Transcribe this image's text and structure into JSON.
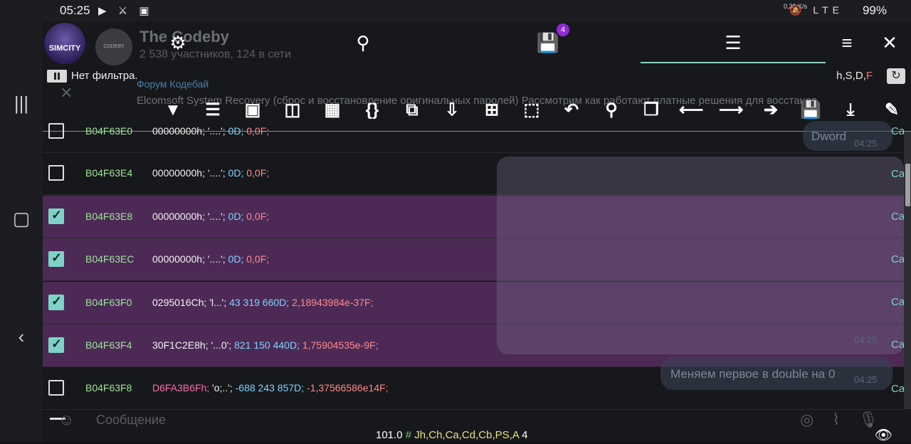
{
  "status_bar": {
    "time": "05:25",
    "left_icons": "▶ ⚔ ▣",
    "net_speed": "0,22\nK/s",
    "right_icons": "🔕 LTE",
    "battery": "99%"
  },
  "telegram": {
    "chat_title": "The Codeby",
    "chat_subtitle": "2 538 участников, 124 в сети",
    "pinned_title": "Форум Кодебай",
    "pinned_text": "Elcomsoft System Recovery (сброс и восстановление оригинальных паролей) Рассмотрим как работают платные решения для восстанов",
    "avatar_game_text": "SIMCITY",
    "avatar_chat_text": "CODEBY",
    "message_placeholder": "Сообщение",
    "bubble_dword": "Dword",
    "bubble_dword_time": "04:25",
    "bubble_change": "Меняем первое в double на 0",
    "bubble_change_time": "04:25",
    "overlay_time": "04:25",
    "side_label": "Ca"
  },
  "gg_top": {
    "badge": "4",
    "filter_text": "Нет фильтра.",
    "types_prefix": "h,S,D,",
    "types_float": "F"
  },
  "gg_toolbar": [
    {
      "name": "filter-icon",
      "glyph": "▼"
    },
    {
      "name": "select-list-icon",
      "glyph": "☰"
    },
    {
      "name": "select-all-icon",
      "glyph": "▣"
    },
    {
      "name": "select-inverse-icon",
      "glyph": "◫"
    },
    {
      "name": "calculator-icon",
      "glyph": "▦"
    },
    {
      "name": "braces-icon",
      "glyph": "{}"
    },
    {
      "name": "copy-move-icon",
      "glyph": "⧉"
    },
    {
      "name": "folder-download-icon",
      "glyph": "⇩"
    },
    {
      "name": "offset-icon",
      "glyph": "⊞"
    },
    {
      "name": "deselect-icon",
      "glyph": "⬚"
    },
    {
      "name": "undo-icon",
      "glyph": "↶"
    },
    {
      "name": "search-plus-icon",
      "glyph": "⚲"
    },
    {
      "name": "copy-icon",
      "glyph": "❐"
    },
    {
      "name": "arrow-left-icon",
      "glyph": "⟵"
    },
    {
      "name": "arrow-right-icon",
      "glyph": "⟶"
    },
    {
      "name": "goto-icon",
      "glyph": "➔"
    },
    {
      "name": "save-icon",
      "glyph": "💾"
    },
    {
      "name": "download-icon",
      "glyph": "⤓"
    },
    {
      "name": "edit-icon",
      "glyph": "✎"
    }
  ],
  "rows": [
    {
      "checked": false,
      "address": "B04F63E0",
      "hex": "00000000h;",
      "str": "'....';",
      "dec": "0D;",
      "flt": "0,0F;",
      "hex_hi": false
    },
    {
      "checked": false,
      "address": "B04F63E4",
      "hex": "00000000h;",
      "str": "'....';",
      "dec": "0D;",
      "flt": "0,0F;",
      "hex_hi": false
    },
    {
      "checked": true,
      "address": "B04F63E8",
      "hex": "00000000h;",
      "str": "'....';",
      "dec": "0D;",
      "flt": "0,0F;",
      "hex_hi": false
    },
    {
      "checked": true,
      "address": "B04F63EC",
      "hex": "00000000h;",
      "str": "'....';",
      "dec": "0D;",
      "flt": "0,0F;",
      "hex_hi": false
    },
    {
      "checked": true,
      "address": "B04F63F0",
      "hex": "0295016Ch;",
      "str": "'l...';",
      "dec": "43 319 660D;",
      "flt": "2,18943984e-37F;",
      "hex_hi": false
    },
    {
      "checked": true,
      "address": "B04F63F4",
      "hex": "30F1C2E8h;",
      "str": "'...0';",
      "dec": "821 150 440D;",
      "flt": "1,75904535e-9F;",
      "hex_hi": false
    },
    {
      "checked": false,
      "address": "B04F63F8",
      "hex": "D6FA3B6Fh;",
      "str": "'o;..';",
      "dec": "-688 243 857D;",
      "flt": "-1,37566586e14F;",
      "hex_hi": true
    }
  ],
  "bottom_status": {
    "value": "101.0",
    "hash": "#",
    "types": "Jh,Ch,Ca,Cd,Cb,PS,A",
    "count": "4"
  }
}
